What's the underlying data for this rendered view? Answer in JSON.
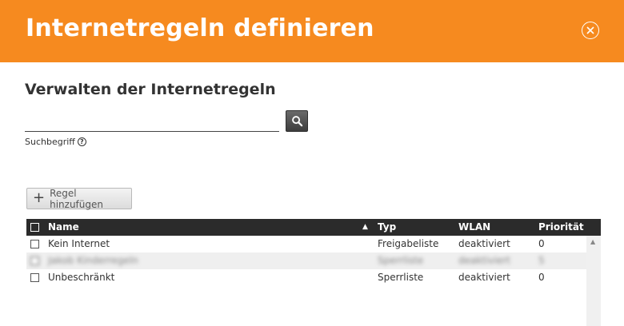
{
  "header": {
    "title": "Internetregeln definieren",
    "close_icon": "close-circle-icon"
  },
  "section": {
    "title": "Verwalten der Internetregeln"
  },
  "search": {
    "value": "",
    "placeholder": "",
    "label": "Suchbegriff",
    "help_glyph": "?",
    "button_icon": "search-icon"
  },
  "toolbar": {
    "add_label": "Regel hinzufügen",
    "add_glyph": "+"
  },
  "table": {
    "columns": {
      "name": "Name",
      "typ": "Typ",
      "wlan": "WLAN",
      "prio": "Priorität"
    },
    "sort_glyph": "▲",
    "rows": [
      {
        "name": "Kein Internet",
        "typ": "Freigabeliste",
        "wlan": "deaktiviert",
        "prio": "0"
      },
      {
        "name": "Jakob Kinderregeln",
        "typ": "Sperrliste",
        "wlan": "deaktiviert",
        "prio": "5"
      },
      {
        "name": "Unbeschränkt",
        "typ": "Sperrliste",
        "wlan": "deaktiviert",
        "prio": "0"
      }
    ],
    "scroll_glyph": "▲"
  },
  "colors": {
    "accent": "#f68a1f",
    "table_header": "#2b2b2b"
  }
}
